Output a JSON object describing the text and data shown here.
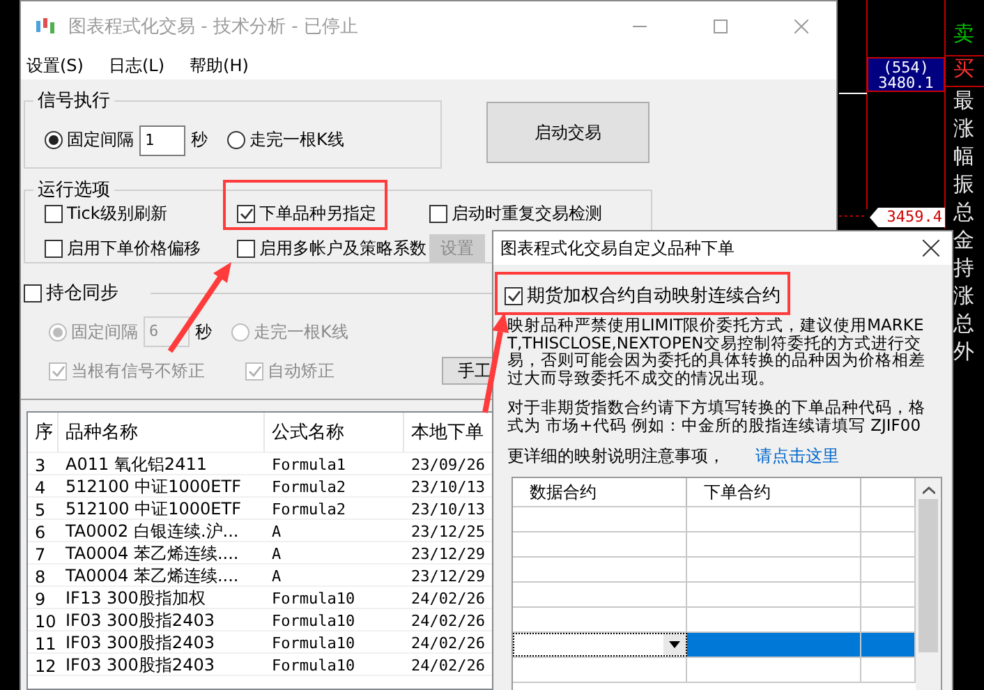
{
  "chart": {
    "price_tag": {
      "volume": "(554)",
      "price": "3480.1"
    },
    "marker_price": "3459.4",
    "side_labels": [
      {
        "text": "卖",
        "kind": "sell"
      },
      {
        "text": "买",
        "kind": "buy"
      },
      {
        "text": "最",
        "kind": "plain"
      },
      {
        "text": "涨",
        "kind": "plain"
      },
      {
        "text": "幅",
        "kind": "plain"
      },
      {
        "text": "振",
        "kind": "plain"
      },
      {
        "text": "总",
        "kind": "plain"
      },
      {
        "text": "金",
        "kind": "plain"
      },
      {
        "text": "持",
        "kind": "plain"
      },
      {
        "text": "涨",
        "kind": "plain"
      },
      {
        "text": "总",
        "kind": "plain"
      },
      {
        "text": "外",
        "kind": "plain"
      }
    ]
  },
  "window": {
    "title": "图表程式化交易 - 技术分析 - 已停止",
    "menu": [
      "设置(S)",
      "日志(L)",
      "帮助(H)"
    ]
  },
  "signal_group": {
    "title": "信号执行",
    "interval_label": "固定间隔",
    "interval_selected": true,
    "interval_value": "1",
    "unit": "秒",
    "bar_label": "走完一根K线",
    "bar_selected": false,
    "start_button": "启动交易"
  },
  "run_options": {
    "title": "运行选项",
    "options": [
      {
        "label": "Tick级别刷新",
        "checked": false
      },
      {
        "label": "下单品种另指定",
        "checked": true
      },
      {
        "label": "启动时重复交易检测",
        "checked": false
      },
      {
        "label": "启用下单价格偏移",
        "checked": false
      },
      {
        "label": "启用多帐户及策略系数",
        "checked": false
      }
    ],
    "settings_button": "设置",
    "settings_disabled": true
  },
  "position_sync": {
    "label": "持仓同步",
    "checked": false,
    "interval_label": "固定间隔",
    "interval_selected": true,
    "interval_value": "6",
    "unit": "秒",
    "bar_label": "走完一根K线",
    "bar_selected": false,
    "options": [
      {
        "label": "当根有信号不矫正",
        "checked": true
      },
      {
        "label": "自动矫正",
        "checked": true
      }
    ],
    "manual_button": "手工"
  },
  "table": {
    "columns": [
      "序",
      "品种名称",
      "公式名称",
      "本地下单"
    ],
    "rows": [
      [
        "3",
        "A011 氧化铝2411",
        "Formula1",
        "23/09/26"
      ],
      [
        "4",
        "512100 中证1000ETF",
        "Formula2",
        "23/10/13"
      ],
      [
        "5",
        "512100 中证1000ETF",
        "Formula2",
        "23/10/13"
      ],
      [
        "6",
        "TA0002 白银连续.沪...",
        "A",
        "23/12/25"
      ],
      [
        "7",
        "TA0004 苯乙烯连续....",
        "A",
        "23/12/29"
      ],
      [
        "8",
        "TA0004 苯乙烯连续....",
        "A",
        "23/12/29"
      ],
      [
        "9",
        "IF13 300股指加权",
        "Formula10",
        "24/02/26"
      ],
      [
        "10",
        "IF03 300股指2403",
        "Formula10",
        "24/02/26"
      ],
      [
        "11",
        "IF03 300股指2403",
        "Formula10",
        "24/02/26"
      ],
      [
        "12",
        "IF03 300股指2403",
        "Formula10",
        "24/02/26"
      ]
    ]
  },
  "dialog": {
    "title": "图表程式化交易自定义品种下单",
    "auto_map_label": "期货加权合约自动映射连续合约",
    "auto_map_checked": true,
    "notice": "映射品种严禁使用LIMIT限价委托方式，建议使用MARKET,THISCLOSE,NEXTOPEN交易控制符委托的方式进行交易，否则可能会因为委托的具体转换的品种因为价格相差过大而导致委托不成交的情况出现。",
    "hint": "对于非期货指数合约请下方填写转换的下单品种代码，格式为 市场+代码 例如：中金所的股指连续请填写 ZJIF00",
    "more_text": "更详细的映射说明注意事项，",
    "more_link": "请点击这里",
    "grid": {
      "columns": [
        "数据合约",
        "下单合约"
      ],
      "rows": [
        {
          "selected": false
        },
        {
          "selected": false
        },
        {
          "selected": false
        },
        {
          "selected": false
        },
        {
          "selected": false
        },
        {
          "selected": true
        },
        {
          "selected": false
        }
      ]
    }
  }
}
